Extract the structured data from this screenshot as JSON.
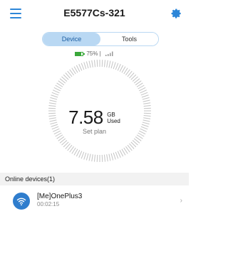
{
  "header": {
    "title": "E5577Cs-321",
    "menu_icon": "menu-icon",
    "settings_icon": "gear-icon",
    "accent": "#2c86d8"
  },
  "tabs": [
    {
      "label": "Device",
      "active": true
    },
    {
      "label": "Tools",
      "active": false
    }
  ],
  "status": {
    "battery_percent": "75%",
    "battery_level": 0.75,
    "separator": "|",
    "signal_icon": "signal-icon",
    "battery_color": "#3aa83a"
  },
  "usage": {
    "value": "7.58",
    "unit": "GB",
    "unit_label": "Used",
    "set_plan_label": "Set plan"
  },
  "online_devices": {
    "title": "Online devices(1)",
    "items": [
      {
        "name": "[Me]OnePlus3",
        "duration": "00:02:15",
        "icon": "wifi-icon"
      }
    ]
  }
}
